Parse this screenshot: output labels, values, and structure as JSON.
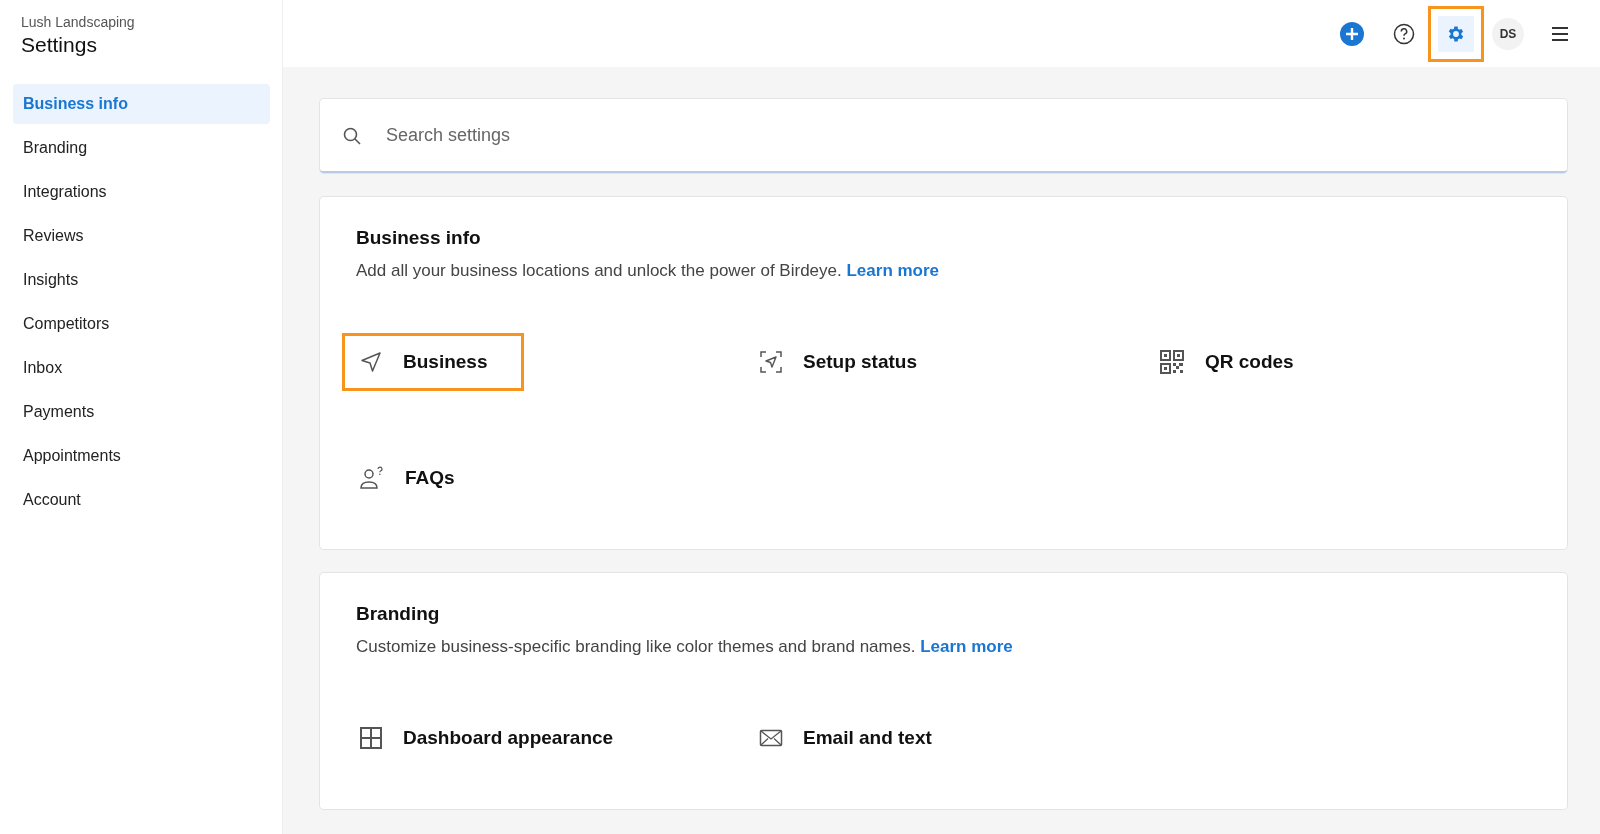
{
  "sidebar": {
    "business_name": "Lush Landscaping",
    "title": "Settings",
    "items": [
      {
        "label": "Business info",
        "selected": true
      },
      {
        "label": "Branding",
        "selected": false
      },
      {
        "label": "Integrations",
        "selected": false
      },
      {
        "label": "Reviews",
        "selected": false
      },
      {
        "label": "Insights",
        "selected": false
      },
      {
        "label": "Competitors",
        "selected": false
      },
      {
        "label": "Inbox",
        "selected": false
      },
      {
        "label": "Payments",
        "selected": false
      },
      {
        "label": "Appointments",
        "selected": false
      },
      {
        "label": "Account",
        "selected": false
      }
    ]
  },
  "top_bar": {
    "buttons": [
      {
        "kind": "add",
        "highlighted": false
      },
      {
        "kind": "help",
        "highlighted": false
      },
      {
        "kind": "settings",
        "highlighted": true
      },
      {
        "kind": "avatar",
        "label": "DS",
        "highlighted": false
      },
      {
        "kind": "menu",
        "highlighted": false
      }
    ]
  },
  "search": {
    "placeholder": "Search settings"
  },
  "sections": [
    {
      "title": "Business info",
      "description": "Add all your business locations and unlock the power of Birdeye.",
      "link": "Learn more",
      "items": [
        {
          "kind": "location",
          "label": "Business",
          "highlighted": true
        },
        {
          "kind": "setup",
          "label": "Setup status",
          "highlighted": false
        },
        {
          "kind": "qr",
          "label": "QR codes",
          "highlighted": false
        },
        {
          "kind": "faq",
          "label": "FAQs",
          "highlighted": false
        }
      ]
    },
    {
      "title": "Branding",
      "description": "Customize business-specific branding like color themes and brand names.",
      "link": "Learn more",
      "items": [
        {
          "kind": "grid",
          "label": "Dashboard appearance",
          "highlighted": false
        },
        {
          "kind": "mail",
          "label": "Email and text",
          "highlighted": false
        }
      ]
    }
  ]
}
